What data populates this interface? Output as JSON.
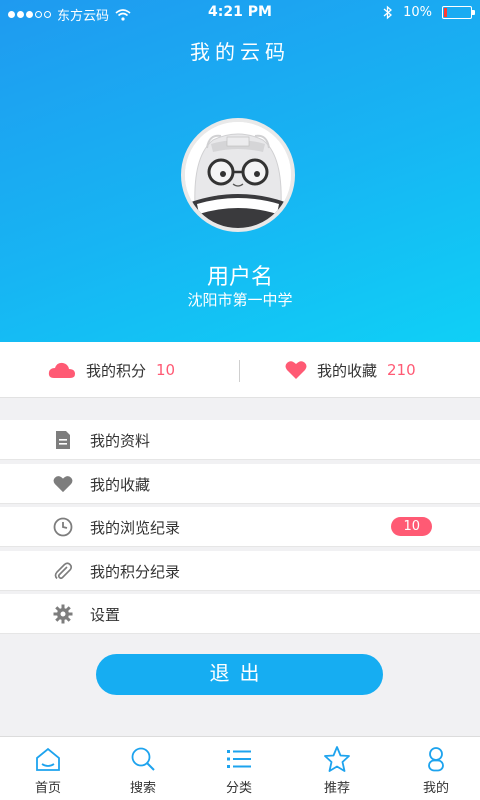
{
  "status_bar": {
    "carrier": "东方云码",
    "time": "4:21 PM",
    "battery": "10%",
    "battery_level": 0.1
  },
  "header": {
    "title": "我的云码"
  },
  "profile": {
    "avatar_icon": "cat-with-glasses-avatar",
    "username": "用户名",
    "school": "沈阳市第一中学"
  },
  "stats": {
    "points_label": "我的积分",
    "points_value": "10",
    "favorites_label": "我的收藏",
    "favorites_value": "210"
  },
  "menu": [
    {
      "label": "我的资料",
      "icon": "document-icon"
    },
    {
      "label": "我的收藏",
      "icon": "heart-icon"
    },
    {
      "label": "我的浏览纪录",
      "icon": "clock-icon",
      "badge": "10"
    },
    {
      "label": "我的积分纪录",
      "icon": "paperclip-icon"
    },
    {
      "label": "设置",
      "icon": "gear-icon"
    }
  ],
  "logout_label": "退出",
  "tabs": [
    {
      "label": "首页",
      "icon": "home-icon"
    },
    {
      "label": "搜索",
      "icon": "search-icon"
    },
    {
      "label": "分类",
      "icon": "list-icon"
    },
    {
      "label": "推荐",
      "icon": "star-icon"
    },
    {
      "label": "我的",
      "icon": "user-icon"
    }
  ],
  "colors": {
    "accent": "#16adf2",
    "highlight": "#ff5a74"
  }
}
